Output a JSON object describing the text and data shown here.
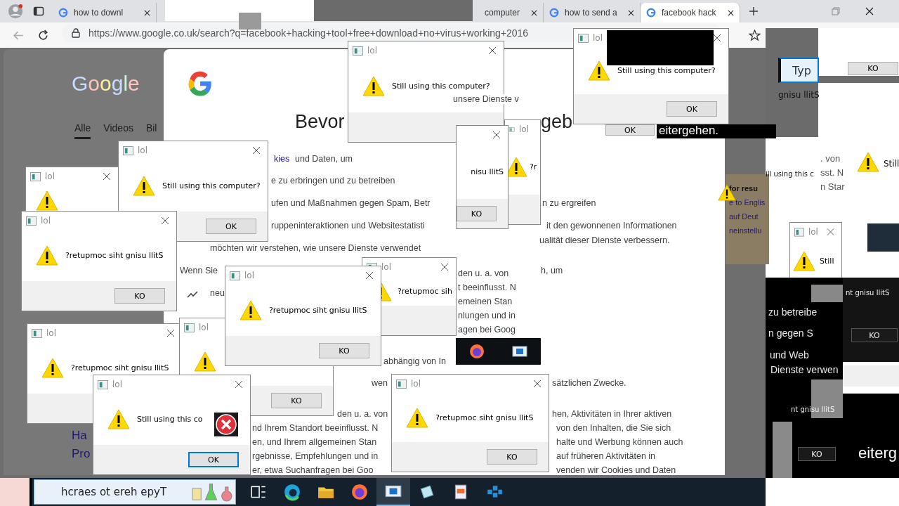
{
  "browser": {
    "tabs": [
      {
        "label": "how to downl",
        "selected": false,
        "favicon": true
      },
      {
        "label": "computer",
        "selected": false,
        "favicon": false
      },
      {
        "label": "how to send a",
        "selected": false,
        "favicon": true
      },
      {
        "label": "facebook hack",
        "selected": true,
        "favicon": true
      }
    ],
    "url": "https://www.google.co.uk/search?q=facebook+hacking+tool+free+download+no+virus+working+2016"
  },
  "google": {
    "logo": "Google",
    "nav": [
      {
        "label": "Alle",
        "selected": true
      },
      {
        "label": "Videos",
        "selected": false
      },
      {
        "label": "Bil",
        "selected": false
      }
    ],
    "results": [
      "Ha",
      "Pro"
    ],
    "side_panel": [
      {
        "text": "for resu",
        "kind": "heading"
      },
      {
        "text": "e to Englis",
        "kind": "link"
      },
      {
        "text": "auf Deut",
        "kind": "link"
      },
      {
        "text": "neinstellu",
        "kind": "link"
      }
    ]
  },
  "consent": {
    "fragments": [
      {
        "text": "Bevor",
        "kind": "heading"
      },
      {
        "text": "geb",
        "kind": "heading"
      },
      {
        "text": "unsere Dienste v",
        "kind": "text"
      },
      {
        "text": "kies",
        "kind": "link"
      },
      {
        "text": "und Daten, um",
        "kind": "text"
      },
      {
        "text": "e zu erbringen und zu betreiben",
        "kind": "text"
      },
      {
        "text": "ufen und Maßnahmen gegen Spam, Betr",
        "kind": "text"
      },
      {
        "text": "n zu ergreifen",
        "kind": "text"
      },
      {
        "text": "ruppeninteraktionen und Websitestatisti",
        "kind": "text"
      },
      {
        "text": "it den gewonnenen Informationen",
        "kind": "text"
      },
      {
        "text": "möchten wir verstehen, wie unsere Dienste verwendet",
        "kind": "text"
      },
      {
        "text": "ualität dieser Dienste verbessern.",
        "kind": "text"
      },
      {
        "text": "Wenn Sie",
        "kind": "text"
      },
      {
        "text": "neu",
        "kind": "text"
      },
      {
        "text": "den u. a. von",
        "kind": "text"
      },
      {
        "text": "h, um",
        "kind": "text"
      },
      {
        "text": "t beeinflusst. N",
        "kind": "text"
      },
      {
        "text": "emeinen Stan",
        "kind": "text"
      },
      {
        "text": "nlungen und in",
        "kind": "text"
      },
      {
        "text": "agen bei Goog",
        "kind": "text"
      },
      {
        "text": "abhängig von In",
        "kind": "text"
      },
      {
        "text": "wen",
        "kind": "text"
      },
      {
        "text": "sätzlichen Zwecke.",
        "kind": "text"
      },
      {
        "text": "den u. a. von",
        "kind": "text"
      },
      {
        "text": "hen, Aktivitäten in Ihrer aktiven",
        "kind": "text"
      },
      {
        "text": "nd Ihrem Standort beeinflusst. N",
        "kind": "text"
      },
      {
        "text": "von den Inhalten, die Sie sich",
        "kind": "text"
      },
      {
        "text": "en, und Ihrem allgemeinen Stan",
        "kind": "text"
      },
      {
        "text": "halte und Werbung können auch",
        "kind": "text"
      },
      {
        "text": "rgebnisse, Empfehlungen und in",
        "kind": "text"
      },
      {
        "text": "auf früheren Aktivitäten in",
        "kind": "text"
      },
      {
        "text": "er, etwa Suchanfragen bei Goo",
        "kind": "text"
      },
      {
        "text": "venden wir Cookies und Daten",
        "kind": "text"
      }
    ]
  },
  "dialogs": [
    {
      "title": "lol",
      "warning": true,
      "error_badge": false
    },
    {
      "title": "lol",
      "message": "Still using this computer?",
      "warning": true,
      "error_badge": false
    },
    {
      "title": "lol",
      "message": "?r",
      "warning": true,
      "error_badge": false
    },
    {
      "message": "nisu llitS",
      "button": "KO",
      "warning": false,
      "error_badge": false,
      "focused": false
    },
    {
      "title": "lol",
      "message": "?retupmoc sih",
      "warning": true,
      "error_badge": false
    },
    {
      "title": "lol",
      "message": "Still using this computer?",
      "button": "OK",
      "warning": true,
      "error_badge": false,
      "focused": false
    },
    {
      "title": "lol",
      "message": "?retupmoc siht gnisu llitS",
      "button": "KO",
      "warning": true,
      "error_badge": false,
      "focused": false
    },
    {
      "title": "lol",
      "message": "?retupmoc siht gnisu llitS",
      "warning": true,
      "error_badge": false
    },
    {
      "title": "lol",
      "button": "KO",
      "warning": true,
      "error_badge": false,
      "focused": false
    },
    {
      "title": "lol",
      "message": "?retupmoc siht gnisu llitS",
      "button": "KO",
      "warning": true,
      "error_badge": false,
      "focused": false
    },
    {
      "title": "lol",
      "message": "Still using this co",
      "button": "OK",
      "warning": true,
      "error_badge": true,
      "focused": true
    },
    {
      "title": "lol",
      "message": "?retupmoc siht gnisu llitS",
      "button": "KO",
      "warning": true,
      "error_badge": false,
      "focused": false
    },
    {
      "title": "lol",
      "message": "Still",
      "warning": true,
      "error_badge": false
    },
    {
      "title": "lol",
      "message": "Still using this computer?",
      "button": "OK",
      "warning": true,
      "error_badge": false,
      "focused": false
    }
  ],
  "fragments": [
    {
      "text": "eitergehen.",
      "kind": "light-big"
    },
    {
      "text": "OK",
      "kind": "button"
    },
    {
      "text": "Typ",
      "kind": "field"
    },
    {
      "text": "KO",
      "kind": "button"
    },
    {
      "text": "gnisu llitS",
      "kind": "text"
    },
    {
      "text": "ill using this c",
      "kind": "small"
    },
    {
      "text": ". von",
      "kind": "grey"
    },
    {
      "text": "sst. N",
      "kind": "grey"
    },
    {
      "text": "n Star",
      "kind": "grey"
    },
    {
      "text": "Still",
      "kind": "text"
    },
    {
      "text": "zu betreibe",
      "kind": "light"
    },
    {
      "text": "n gegen S",
      "kind": "light"
    },
    {
      "text": "und Web",
      "kind": "light"
    },
    {
      "text": "Dienste verwen",
      "kind": "light"
    },
    {
      "text": "nt gnisu llitS",
      "kind": "light-small"
    },
    {
      "text": "KO",
      "kind": "dark-button"
    },
    {
      "text": "nt gnisu llitS",
      "kind": "light-small"
    },
    {
      "text": "KO",
      "kind": "dark-button"
    },
    {
      "text": "eiterg",
      "kind": "light-huge"
    }
  ],
  "taskbar": {
    "search": {
      "placeholder": "hcraes ot ereh epyT"
    },
    "apps": [
      {
        "kind": "task-view",
        "selected": false
      },
      {
        "kind": "edge",
        "selected": false
      },
      {
        "kind": "folder",
        "selected": false
      },
      {
        "kind": "firefox",
        "selected": false
      },
      {
        "kind": "window",
        "selected": true
      },
      {
        "kind": "notepad",
        "selected": false
      },
      {
        "kind": "document",
        "selected": false
      },
      {
        "kind": "cubes",
        "selected": false
      }
    ]
  }
}
